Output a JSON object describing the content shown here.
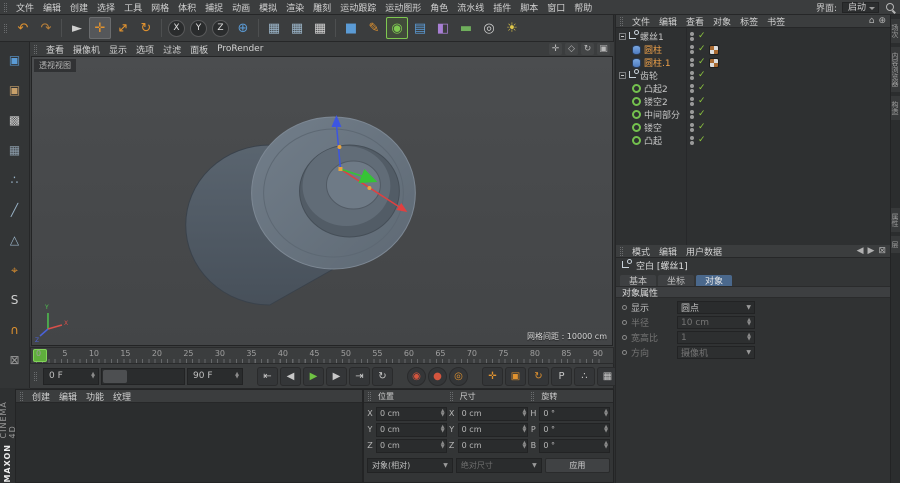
{
  "colors": {
    "accent_orange": "#e0922f",
    "selection_text": "#f0a24a",
    "check_green": "#8dc63f",
    "play_green": "#6fc243",
    "record_red": "#d4553e",
    "active_tab_blue": "#4a688c",
    "axis_x_red": "#d8504a",
    "axis_y_green": "#4fc44f",
    "axis_z_blue": "#4a62d8",
    "object_surface": "#68747f"
  },
  "menubar": {
    "items": [
      "文件",
      "编辑",
      "创建",
      "选择",
      "工具",
      "网格",
      "体积",
      "捕捉",
      "动画",
      "模拟",
      "渲染",
      "雕刻",
      "运动跟踪",
      "运动图形",
      "角色",
      "流水线",
      "插件",
      "脚本",
      "窗口",
      "帮助"
    ],
    "interface_label": "界面:",
    "interface_value": "启动"
  },
  "toolbar": {
    "icons": [
      {
        "name": "undo",
        "glyph": "↶"
      },
      {
        "name": "redo",
        "glyph": "↷"
      },
      {
        "name": "live-selection",
        "glyph": "►"
      },
      {
        "name": "move-tool",
        "glyph": "✛"
      },
      {
        "name": "scale-tool",
        "glyph": "↔"
      },
      {
        "name": "rotate-tool",
        "glyph": "↻"
      },
      {
        "name": "lock-x-axis",
        "glyph": "X"
      },
      {
        "name": "lock-y-axis",
        "glyph": "Y"
      },
      {
        "name": "lock-z-axis",
        "glyph": "Z"
      },
      {
        "name": "coordinate-system",
        "glyph": "⊕"
      },
      {
        "name": "render-view",
        "glyph": "▦"
      },
      {
        "name": "render-picture-viewer",
        "glyph": "▦"
      },
      {
        "name": "render-settings",
        "glyph": "▦"
      },
      {
        "name": "add-cube",
        "glyph": "■"
      },
      {
        "name": "pen-tool",
        "glyph": "✎"
      },
      {
        "name": "subdivision-surface",
        "glyph": "◉"
      },
      {
        "name": "array-object",
        "glyph": "▤"
      },
      {
        "name": "deformer",
        "glyph": "◧"
      },
      {
        "name": "floor-object",
        "glyph": "▬"
      },
      {
        "name": "camera-object",
        "glyph": "◎"
      },
      {
        "name": "light-object",
        "glyph": "☀"
      }
    ]
  },
  "left_toolbar": {
    "icons": [
      {
        "name": "make-editable",
        "glyph": "▣"
      },
      {
        "name": "model-mode",
        "glyph": "▣"
      },
      {
        "name": "texture-mode",
        "glyph": "▩"
      },
      {
        "name": "workplane-mode",
        "glyph": "▦"
      },
      {
        "name": "points-mode",
        "glyph": "∴"
      },
      {
        "name": "edges-mode",
        "glyph": "╱"
      },
      {
        "name": "polygons-mode",
        "glyph": "△"
      },
      {
        "name": "enable-axis",
        "glyph": "⌖"
      },
      {
        "name": "viewport-solo",
        "glyph": "S"
      },
      {
        "name": "enable-snap",
        "glyph": "∩"
      },
      {
        "name": "lock-workplane",
        "glyph": "⊠"
      }
    ]
  },
  "viewport": {
    "menu": [
      "查看",
      "摄像机",
      "显示",
      "选项",
      "过滤",
      "面板",
      "ProRender"
    ],
    "controls": [
      {
        "name": "viewport-pan",
        "glyph": "✛"
      },
      {
        "name": "viewport-zoom",
        "glyph": "◇"
      },
      {
        "name": "viewport-rotate",
        "glyph": "↻"
      },
      {
        "name": "viewport-maximize",
        "glyph": "▣"
      }
    ],
    "view_label": "透视视图",
    "grid_info": "网格间距 : 10000 cm",
    "axis_labels": {
      "x": "X",
      "y": "Y",
      "z": "Z"
    }
  },
  "object_manager": {
    "menu": [
      "文件",
      "编辑",
      "查看",
      "对象",
      "标签",
      "书签"
    ],
    "corner_icons": [
      {
        "name": "home",
        "glyph": "⌂"
      },
      {
        "name": "scroll-to-active",
        "glyph": "⊕"
      }
    ],
    "objects": [
      {
        "name": "螺丝1"
      },
      {
        "name": "圆柱"
      },
      {
        "name": "圆柱.1"
      },
      {
        "name": "齿轮"
      },
      {
        "name": "凸起2"
      },
      {
        "name": "镂空2"
      },
      {
        "name": "中间部分"
      },
      {
        "name": "镂空"
      },
      {
        "name": "凸起"
      }
    ]
  },
  "attribute_manager": {
    "menu": [
      "模式",
      "编辑",
      "用户数据"
    ],
    "icons": [
      {
        "name": "history-back",
        "glyph": "◀"
      },
      {
        "name": "history-forward",
        "glyph": "▶"
      },
      {
        "name": "lock",
        "glyph": "⊠"
      }
    ],
    "title": "空白 [螺丝1]",
    "tabs": [
      "基本",
      "坐标",
      "对象"
    ],
    "section": "对象属性",
    "properties": [
      {
        "label": "显示",
        "value": "圆点"
      },
      {
        "label": "半径",
        "value": "10 cm"
      },
      {
        "label": "宽高比",
        "value": "1"
      },
      {
        "label": "方向",
        "value": "摄像机"
      }
    ]
  },
  "right_edge": {
    "tabs": [
      "场次",
      "内容浏览器",
      "构造",
      "属性",
      "层"
    ]
  },
  "timeline": {
    "ticks": [
      "0",
      "5",
      "10",
      "15",
      "20",
      "25",
      "30",
      "35",
      "40",
      "45",
      "50",
      "55",
      "60",
      "65",
      "70",
      "75",
      "80",
      "85",
      "90"
    ]
  },
  "transport": {
    "current_frame": "0 F",
    "range_end": "90 F",
    "buttons": [
      {
        "name": "goto-start",
        "glyph": "⇤"
      },
      {
        "name": "prev-frame",
        "glyph": "◀"
      },
      {
        "name": "play",
        "glyph": "▶"
      },
      {
        "name": "next-frame",
        "glyph": "▶"
      },
      {
        "name": "goto-end",
        "glyph": "⇥"
      },
      {
        "name": "loop-playback",
        "glyph": "↻"
      }
    ],
    "record_buttons": [
      {
        "name": "record-keyframe",
        "glyph": "◉"
      },
      {
        "name": "autokeying",
        "glyph": "●"
      },
      {
        "name": "keyframe-selection",
        "glyph": "◎"
      }
    ],
    "key_toggles": [
      {
        "name": "key-position",
        "glyph": "✛"
      },
      {
        "name": "key-scale",
        "glyph": "▣"
      },
      {
        "name": "key-rotation",
        "glyph": "↻"
      },
      {
        "name": "key-parameter",
        "glyph": "P"
      },
      {
        "name": "key-pla",
        "glyph": "∴"
      },
      {
        "name": "minimal-interface",
        "glyph": "▦"
      }
    ]
  },
  "material_manager": {
    "menu": [
      "创建",
      "编辑",
      "功能",
      "纹理"
    ]
  },
  "coordinates": {
    "groups": [
      "位置",
      "尺寸",
      "旋转"
    ],
    "rows": [
      {
        "p_label": "X",
        "p_value": "0 cm",
        "s_label": "X",
        "s_value": "0 cm",
        "r_label": "H",
        "r_value": "0 °"
      },
      {
        "p_label": "Y",
        "p_value": "0 cm",
        "s_label": "Y",
        "s_value": "0 cm",
        "r_label": "P",
        "r_value": "0 °"
      },
      {
        "p_label": "Z",
        "p_value": "0 cm",
        "s_label": "Z",
        "s_value": "0 cm",
        "r_label": "B",
        "r_value": "0 °"
      }
    ],
    "mode_object": "对象(相对)",
    "mode_size": "绝对尺寸",
    "apply": "应用"
  },
  "branding": {
    "line1": "MAXON",
    "line2": "CINEMA 4D"
  }
}
